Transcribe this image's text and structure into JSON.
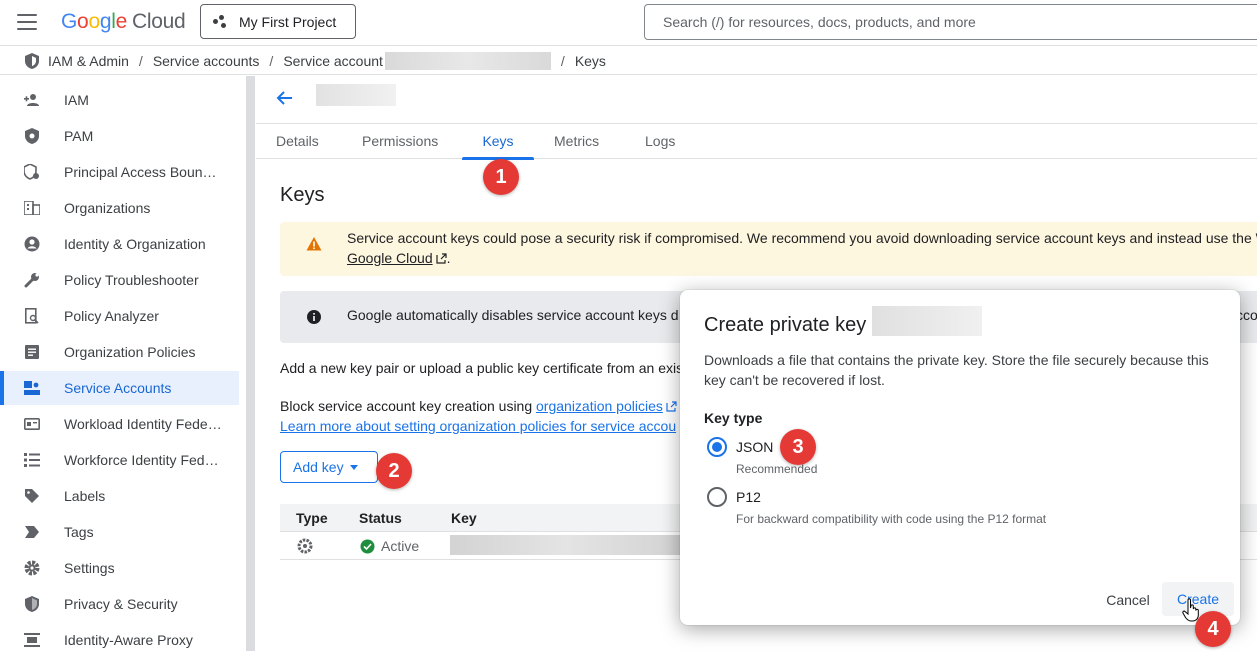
{
  "topbar": {
    "logo_google": "Google",
    "logo_cloud": "Cloud",
    "project": "My First Project",
    "search_placeholder": "Search (/) for resources, docs, products, and more"
  },
  "breadcrumb": {
    "items": [
      "IAM & Admin",
      "Service accounts",
      "Service account",
      "Keys"
    ],
    "separator": "/"
  },
  "sidebar": {
    "items": [
      {
        "label": "IAM",
        "icon": "person-add-icon"
      },
      {
        "label": "PAM",
        "icon": "shield-icon"
      },
      {
        "label": "Principal Access Boun…",
        "icon": "shield-gear-icon"
      },
      {
        "label": "Organizations",
        "icon": "building-icon"
      },
      {
        "label": "Identity & Organization",
        "icon": "account-circle-icon"
      },
      {
        "label": "Policy Troubleshooter",
        "icon": "wrench-icon"
      },
      {
        "label": "Policy Analyzer",
        "icon": "document-search-icon"
      },
      {
        "label": "Organization Policies",
        "icon": "list-document-icon"
      },
      {
        "label": "Service Accounts",
        "icon": "service-account-icon",
        "active": true
      },
      {
        "label": "Workload Identity Fede…",
        "icon": "id-card-icon"
      },
      {
        "label": "Workforce Identity Fed…",
        "icon": "list-icon"
      },
      {
        "label": "Labels",
        "icon": "tag-icon"
      },
      {
        "label": "Tags",
        "icon": "chevron-tag-icon"
      },
      {
        "label": "Settings",
        "icon": "gear-icon"
      },
      {
        "label": "Privacy & Security",
        "icon": "shield-lock-icon"
      },
      {
        "label": "Identity-Aware Proxy",
        "icon": "proxy-icon"
      }
    ]
  },
  "tabs": [
    "Details",
    "Permissions",
    "Keys",
    "Metrics",
    "Logs"
  ],
  "active_tab": "Keys",
  "content": {
    "heading": "Keys",
    "warning_text": "Service account keys could pose a security risk if compromised. We recommend you avoid downloading service account keys and instead use the W",
    "warning_link": "Google Cloud",
    "warning_end": ".",
    "info_text": "Google automatically disables service account keys d",
    "info_right": "ccou",
    "add_text": "Add a new key pair or upload a public key certificate from an exis",
    "block_text": "Block service account key creation using ",
    "block_link": "organization policies",
    "learn_link": "Learn more about setting organization policies for service accou",
    "add_key_label": "Add key"
  },
  "table": {
    "headers": [
      "Type",
      "Status",
      "Key"
    ],
    "rows": [
      {
        "status": "Active"
      }
    ]
  },
  "dialog": {
    "title": "Create private key for",
    "description": "Downloads a file that contains the private key. Store the file securely because this key can't be recovered if lost.",
    "key_type_label": "Key type",
    "options": [
      {
        "label": "JSON",
        "sub": "Recommended",
        "selected": true
      },
      {
        "label": "P12",
        "sub": "For backward compatibility with code using the P12 format",
        "selected": false
      }
    ],
    "cancel_label": "Cancel",
    "create_label": "Create"
  },
  "callouts": [
    "1",
    "2",
    "3",
    "4"
  ],
  "colors": {
    "accent": "#1a73e8",
    "badge": "#e53935",
    "warning_bg": "#fef7e0",
    "info_bg": "#e8eaed",
    "active_nav_bg": "#e8f0fe"
  }
}
